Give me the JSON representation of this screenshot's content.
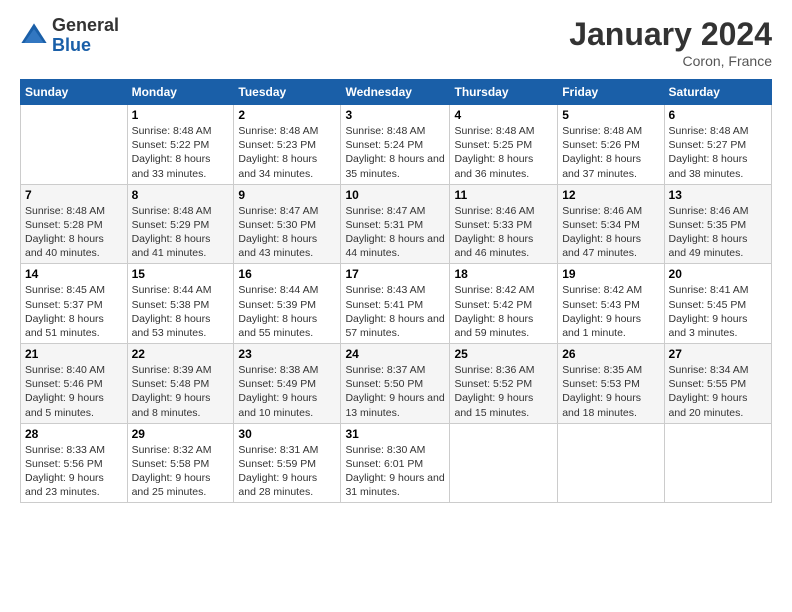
{
  "logo": {
    "general": "General",
    "blue": "Blue"
  },
  "title": "January 2024",
  "location": "Coron, France",
  "days_header": [
    "Sunday",
    "Monday",
    "Tuesday",
    "Wednesday",
    "Thursday",
    "Friday",
    "Saturday"
  ],
  "weeks": [
    [
      {
        "day": "",
        "sunrise": "",
        "sunset": "",
        "daylight": ""
      },
      {
        "day": "1",
        "sunrise": "Sunrise: 8:48 AM",
        "sunset": "Sunset: 5:22 PM",
        "daylight": "Daylight: 8 hours and 33 minutes."
      },
      {
        "day": "2",
        "sunrise": "Sunrise: 8:48 AM",
        "sunset": "Sunset: 5:23 PM",
        "daylight": "Daylight: 8 hours and 34 minutes."
      },
      {
        "day": "3",
        "sunrise": "Sunrise: 8:48 AM",
        "sunset": "Sunset: 5:24 PM",
        "daylight": "Daylight: 8 hours and 35 minutes."
      },
      {
        "day": "4",
        "sunrise": "Sunrise: 8:48 AM",
        "sunset": "Sunset: 5:25 PM",
        "daylight": "Daylight: 8 hours and 36 minutes."
      },
      {
        "day": "5",
        "sunrise": "Sunrise: 8:48 AM",
        "sunset": "Sunset: 5:26 PM",
        "daylight": "Daylight: 8 hours and 37 minutes."
      },
      {
        "day": "6",
        "sunrise": "Sunrise: 8:48 AM",
        "sunset": "Sunset: 5:27 PM",
        "daylight": "Daylight: 8 hours and 38 minutes."
      }
    ],
    [
      {
        "day": "7",
        "sunrise": "Sunrise: 8:48 AM",
        "sunset": "Sunset: 5:28 PM",
        "daylight": "Daylight: 8 hours and 40 minutes."
      },
      {
        "day": "8",
        "sunrise": "Sunrise: 8:48 AM",
        "sunset": "Sunset: 5:29 PM",
        "daylight": "Daylight: 8 hours and 41 minutes."
      },
      {
        "day": "9",
        "sunrise": "Sunrise: 8:47 AM",
        "sunset": "Sunset: 5:30 PM",
        "daylight": "Daylight: 8 hours and 43 minutes."
      },
      {
        "day": "10",
        "sunrise": "Sunrise: 8:47 AM",
        "sunset": "Sunset: 5:31 PM",
        "daylight": "Daylight: 8 hours and 44 minutes."
      },
      {
        "day": "11",
        "sunrise": "Sunrise: 8:46 AM",
        "sunset": "Sunset: 5:33 PM",
        "daylight": "Daylight: 8 hours and 46 minutes."
      },
      {
        "day": "12",
        "sunrise": "Sunrise: 8:46 AM",
        "sunset": "Sunset: 5:34 PM",
        "daylight": "Daylight: 8 hours and 47 minutes."
      },
      {
        "day": "13",
        "sunrise": "Sunrise: 8:46 AM",
        "sunset": "Sunset: 5:35 PM",
        "daylight": "Daylight: 8 hours and 49 minutes."
      }
    ],
    [
      {
        "day": "14",
        "sunrise": "Sunrise: 8:45 AM",
        "sunset": "Sunset: 5:37 PM",
        "daylight": "Daylight: 8 hours and 51 minutes."
      },
      {
        "day": "15",
        "sunrise": "Sunrise: 8:44 AM",
        "sunset": "Sunset: 5:38 PM",
        "daylight": "Daylight: 8 hours and 53 minutes."
      },
      {
        "day": "16",
        "sunrise": "Sunrise: 8:44 AM",
        "sunset": "Sunset: 5:39 PM",
        "daylight": "Daylight: 8 hours and 55 minutes."
      },
      {
        "day": "17",
        "sunrise": "Sunrise: 8:43 AM",
        "sunset": "Sunset: 5:41 PM",
        "daylight": "Daylight: 8 hours and 57 minutes."
      },
      {
        "day": "18",
        "sunrise": "Sunrise: 8:42 AM",
        "sunset": "Sunset: 5:42 PM",
        "daylight": "Daylight: 8 hours and 59 minutes."
      },
      {
        "day": "19",
        "sunrise": "Sunrise: 8:42 AM",
        "sunset": "Sunset: 5:43 PM",
        "daylight": "Daylight: 9 hours and 1 minute."
      },
      {
        "day": "20",
        "sunrise": "Sunrise: 8:41 AM",
        "sunset": "Sunset: 5:45 PM",
        "daylight": "Daylight: 9 hours and 3 minutes."
      }
    ],
    [
      {
        "day": "21",
        "sunrise": "Sunrise: 8:40 AM",
        "sunset": "Sunset: 5:46 PM",
        "daylight": "Daylight: 9 hours and 5 minutes."
      },
      {
        "day": "22",
        "sunrise": "Sunrise: 8:39 AM",
        "sunset": "Sunset: 5:48 PM",
        "daylight": "Daylight: 9 hours and 8 minutes."
      },
      {
        "day": "23",
        "sunrise": "Sunrise: 8:38 AM",
        "sunset": "Sunset: 5:49 PM",
        "daylight": "Daylight: 9 hours and 10 minutes."
      },
      {
        "day": "24",
        "sunrise": "Sunrise: 8:37 AM",
        "sunset": "Sunset: 5:50 PM",
        "daylight": "Daylight: 9 hours and 13 minutes."
      },
      {
        "day": "25",
        "sunrise": "Sunrise: 8:36 AM",
        "sunset": "Sunset: 5:52 PM",
        "daylight": "Daylight: 9 hours and 15 minutes."
      },
      {
        "day": "26",
        "sunrise": "Sunrise: 8:35 AM",
        "sunset": "Sunset: 5:53 PM",
        "daylight": "Daylight: 9 hours and 18 minutes."
      },
      {
        "day": "27",
        "sunrise": "Sunrise: 8:34 AM",
        "sunset": "Sunset: 5:55 PM",
        "daylight": "Daylight: 9 hours and 20 minutes."
      }
    ],
    [
      {
        "day": "28",
        "sunrise": "Sunrise: 8:33 AM",
        "sunset": "Sunset: 5:56 PM",
        "daylight": "Daylight: 9 hours and 23 minutes."
      },
      {
        "day": "29",
        "sunrise": "Sunrise: 8:32 AM",
        "sunset": "Sunset: 5:58 PM",
        "daylight": "Daylight: 9 hours and 25 minutes."
      },
      {
        "day": "30",
        "sunrise": "Sunrise: 8:31 AM",
        "sunset": "Sunset: 5:59 PM",
        "daylight": "Daylight: 9 hours and 28 minutes."
      },
      {
        "day": "31",
        "sunrise": "Sunrise: 8:30 AM",
        "sunset": "Sunset: 6:01 PM",
        "daylight": "Daylight: 9 hours and 31 minutes."
      },
      {
        "day": "",
        "sunrise": "",
        "sunset": "",
        "daylight": ""
      },
      {
        "day": "",
        "sunrise": "",
        "sunset": "",
        "daylight": ""
      },
      {
        "day": "",
        "sunrise": "",
        "sunset": "",
        "daylight": ""
      }
    ]
  ]
}
